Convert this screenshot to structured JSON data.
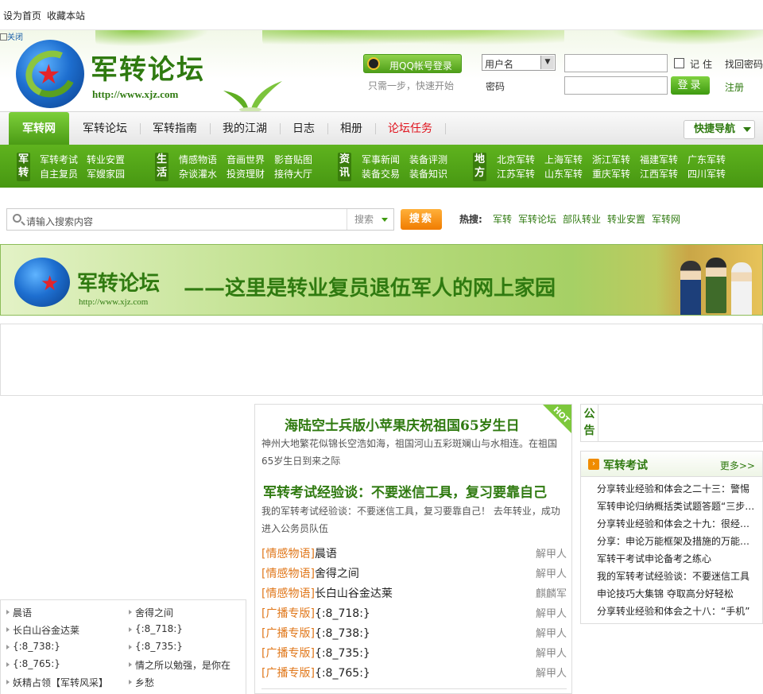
{
  "topbar": {
    "set_home": "设为首页",
    "bookmark": "收藏本站",
    "close": "关闭"
  },
  "header": {
    "logo_text": "军转论坛",
    "logo_url": "http://www.xjz.com",
    "qq_login": "用QQ帐号登录",
    "qq_tip": "只需一步，快速开始",
    "username_select": "用户名",
    "password_label": "密码",
    "remember_label": "记住",
    "login_button": "登录",
    "find_password": "找回密码",
    "register": "注册"
  },
  "nav": {
    "items": [
      "军转网",
      "军转论坛",
      "军转指南",
      "我的江湖",
      "日志",
      "相册",
      "论坛任务"
    ],
    "quick_nav": "快捷导航"
  },
  "categories": [
    {
      "head": "军转",
      "links": [
        "军转考试",
        "转业安置",
        "自主复员",
        "军嫂家园"
      ]
    },
    {
      "head": "生活",
      "links": [
        "情感物语",
        "音画世界",
        "影音贴图",
        "杂谈灌水",
        "投资理财",
        "接待大厅"
      ]
    },
    {
      "head": "资讯",
      "links": [
        "军事新闻",
        "装备评测",
        "装备交易",
        "装备知识"
      ]
    },
    {
      "head": "地方",
      "links": [
        "北京军转",
        "上海军转",
        "浙江军转",
        "福建军转",
        "广东军转",
        "江苏军转",
        "山东军转",
        "重庆军转",
        "江西军转",
        "四川军转"
      ]
    }
  ],
  "search": {
    "placeholder": "请输入搜索内容",
    "select": "搜索",
    "button": "搜索",
    "hot_label": "热搜:",
    "hot_links": [
      "军转",
      "军转论坛",
      "部队转业",
      "转业安置",
      "军转网"
    ]
  },
  "banner": {
    "title": "军转论坛",
    "url": "http://www.xjz.com",
    "slogan": "——这里是转业复员退伍军人的网上家园"
  },
  "left_list": [
    [
      "晨语",
      "舍得之间"
    ],
    [
      "长白山谷金达莱",
      "{:8_718:}"
    ],
    [
      "{:8_738:}",
      "{:8_735:}"
    ],
    [
      "{:8_765:}",
      "情之所以勉强，是你在"
    ],
    [
      "妖精占领【军转风采】",
      "乡愁"
    ]
  ],
  "middle": {
    "hot_badge": "HOT",
    "headline1": "海陆空士兵版小苹果庆祝祖国65岁生日",
    "summary1": "神州大地繁花似锦长空浩如海，祖国河山五彩斑斓山与水相连。在祖国65岁生日到来之际",
    "headline2": "军转考试经验谈：不要迷信工具，复习要靠自己",
    "summary2": "我的军转考试经验谈：不要迷信工具，复习要靠自己！ 去年转业，成功进入公务员队伍",
    "rows": [
      {
        "tag": "[情感物语]",
        "title": "晨语",
        "author": "解甲人"
      },
      {
        "tag": "[情感物语]",
        "title": "舍得之间",
        "author": "解甲人"
      },
      {
        "tag": "[情感物语]",
        "title": "长白山谷金达莱",
        "author": "麒麟军"
      },
      {
        "tag": "[广播专版]",
        "title": "{:8_718:}",
        "author": "解甲人"
      },
      {
        "tag": "[广播专版]",
        "title": "{:8_738:}",
        "author": "解甲人"
      },
      {
        "tag": "[广播专版]",
        "title": "{:8_735:}",
        "author": "解甲人"
      },
      {
        "tag": "[广播专版]",
        "title": "{:8_765:}",
        "author": "解甲人"
      }
    ]
  },
  "right": {
    "notice_label": "公告",
    "exam_title": "军转考试",
    "exam_more": "更多>>",
    "exam_items": [
      "分享转业经验和体会之二十三：警惕",
      "军转申论归纳概括类试题答题“三步法”",
      "分享转业经验和体会之十九：很经典的",
      "分享：申论万能框架及措施的万能模板",
      "军转干考试申论备考之练心",
      "我的军转考试经验谈：不要迷信工具",
      "申论技巧大集锦 夺取高分好轻松",
      "分享转业经验和体会之十八：“手机”"
    ]
  },
  "colors": {
    "brand_green": "#2f7a10",
    "nav_green": "#5fb31e",
    "accent_orange": "#f07c00",
    "alert_red": "#e0121c"
  }
}
